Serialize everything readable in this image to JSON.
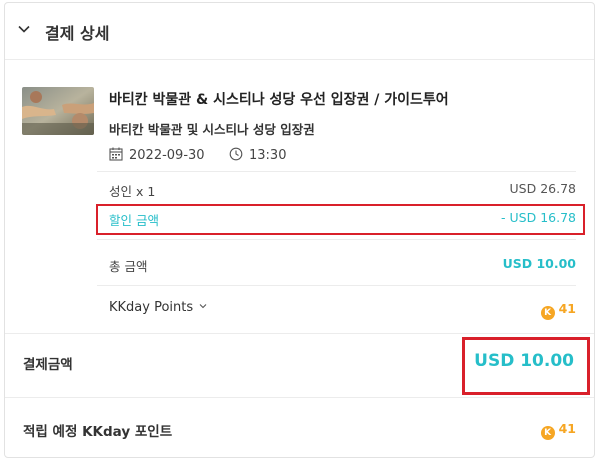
{
  "header": {
    "title": "결제 상세"
  },
  "product": {
    "title": "바티칸 박물관 & 시스티나 성당 우선 입장권 / 가이드투어",
    "subtitle": "바티칸 박물관 및 시스티나 성당 입장권",
    "date": "2022-09-30",
    "time": "13:30"
  },
  "rows": {
    "adult_label": "성인 x 1",
    "adult_value": "USD 26.78",
    "discount_label": "할인 금액",
    "discount_value": "- USD 16.78",
    "total_label": "총 금액",
    "total_value": "USD 10.00",
    "points_label": "KKday Points",
    "points_value": "41",
    "points_icon": "K"
  },
  "payment": {
    "label": "결제금액",
    "value": "USD 10.00"
  },
  "earn": {
    "label": "적립 예정 KKday 포인트",
    "value": "41",
    "icon": "K"
  },
  "colors": {
    "accent": "#26bec9",
    "highlight_border": "#d9202a",
    "coin": "#f6a623"
  }
}
